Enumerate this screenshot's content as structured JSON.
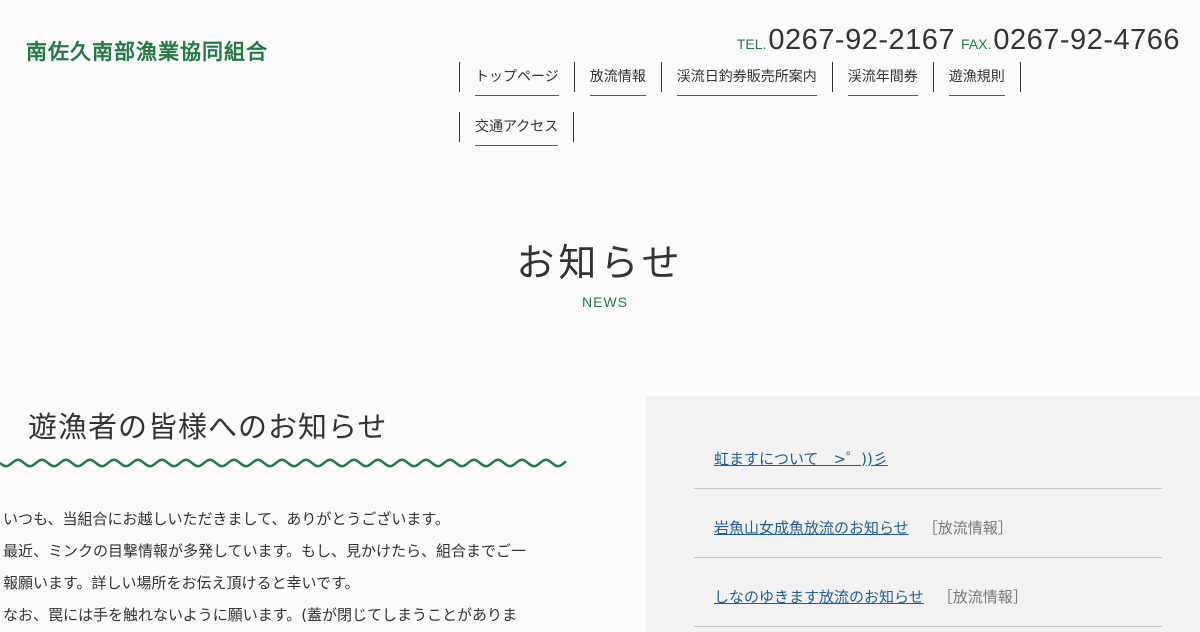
{
  "header": {
    "logo": "南佐久南部漁業協同組合",
    "tel_label": "TEL.",
    "tel": "0267-92-2167",
    "fax_label": "FAX.",
    "fax": "0267-92-4766"
  },
  "nav": {
    "items": [
      {
        "label": "トップページ"
      },
      {
        "label": "放流情報"
      },
      {
        "label": "渓流日釣券販売所案内"
      },
      {
        "label": "渓流年間券"
      },
      {
        "label": "遊漁規則"
      },
      {
        "label": "交通アクセス"
      }
    ]
  },
  "hero": {
    "title": "お知らせ",
    "subtitle": "NEWS"
  },
  "post": {
    "title": "遊漁者の皆様へのお知らせ",
    "lines": [
      "いつも、当組合にお越しいただきまして、ありがとうございます。",
      "最近、ミンクの目撃情報が多発しています。もし、見かけたら、組合までご一",
      "報願います。詳しい場所をお伝え頂けると幸いです。",
      "なお、罠には手を触れないように願います。(蓋が閉じてしまうことがありま"
    ]
  },
  "sidebar": {
    "items": [
      {
        "title": "虹ますについて　>゜))彡",
        "category": ""
      },
      {
        "title": "岩魚山女成魚放流のお知らせ",
        "category": "［放流情報］"
      },
      {
        "title": "しなのゆきます放流のお知らせ",
        "category": "［放流情報］"
      }
    ]
  },
  "colors": {
    "accent": "#237a45",
    "link": "#1f5c99",
    "sidebar_bg": "#f2f2f2"
  }
}
